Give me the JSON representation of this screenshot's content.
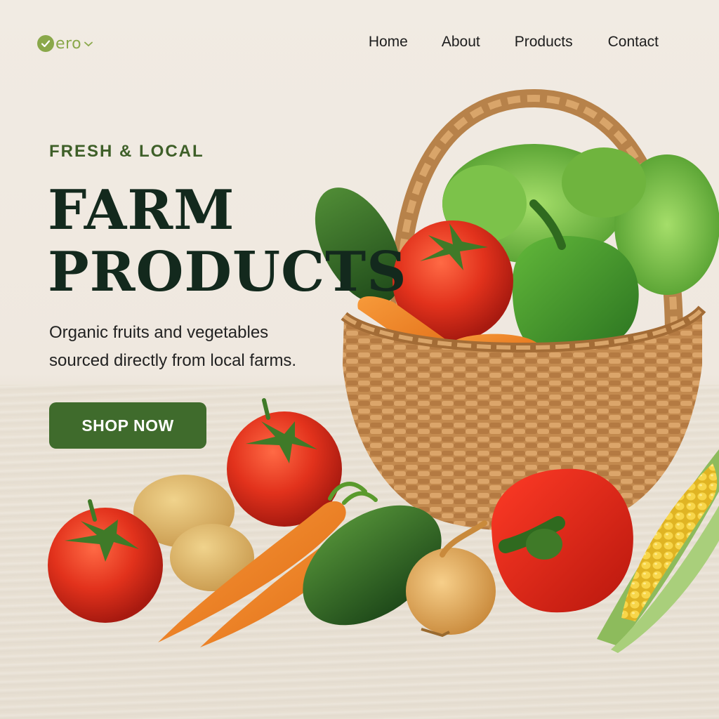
{
  "header": {
    "logo_text": "ero",
    "logo_icon": "check-circle-icon",
    "nav": {
      "home": "Home",
      "about": "About",
      "products": "Products",
      "contact": "Contact"
    }
  },
  "hero": {
    "eyebrow": "FRESH & LOCAL",
    "headline_line1": "FARM",
    "headline_line2": "PRODUCTS",
    "subtitle_line1": "Organic fruits and vegetables",
    "subtitle_line2": "sourced directly from local farms.",
    "cta_label": "SHOP NOW"
  },
  "colors": {
    "background": "#f1ebe3",
    "accent_green": "#3f6b2c",
    "eyebrow_green": "#3e5f28",
    "headline": "#13291d",
    "logo_green": "#8aa84a"
  }
}
